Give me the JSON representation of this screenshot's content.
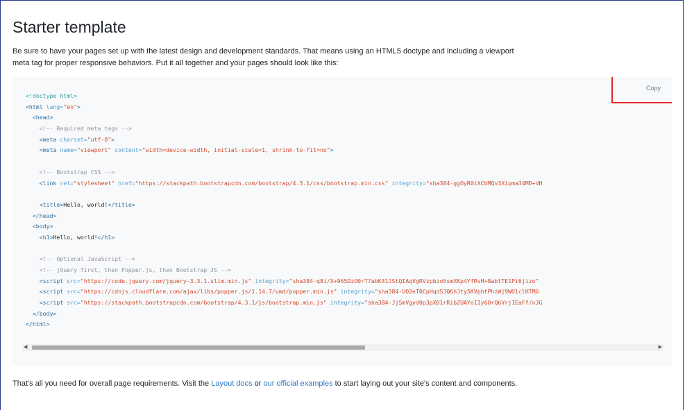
{
  "title": "Starter template",
  "intro": "Be sure to have your pages set up with the latest design and development standards. That means using an HTML5 doctype and including a viewport meta tag for proper responsive behaviors. Put it all together and your pages should look like this:",
  "copy_label": "Copy",
  "code_lines": [
    [
      {
        "c": "doc",
        "t": "<!doctype html>"
      }
    ],
    [
      {
        "c": "tag",
        "t": "<html"
      },
      {
        "c": "attr",
        "t": " lang="
      },
      {
        "c": "str",
        "t": "\"en\""
      },
      {
        "c": "tag",
        "t": ">"
      }
    ],
    [
      {
        "c": "txt",
        "t": "  "
      },
      {
        "c": "tag",
        "t": "<head>"
      }
    ],
    [
      {
        "c": "txt",
        "t": "    "
      },
      {
        "c": "com",
        "t": "<!-- Required meta tags -->"
      }
    ],
    [
      {
        "c": "txt",
        "t": "    "
      },
      {
        "c": "tag",
        "t": "<meta"
      },
      {
        "c": "attr",
        "t": " charset="
      },
      {
        "c": "str",
        "t": "\"utf-8\""
      },
      {
        "c": "tag",
        "t": ">"
      }
    ],
    [
      {
        "c": "txt",
        "t": "    "
      },
      {
        "c": "tag",
        "t": "<meta"
      },
      {
        "c": "attr",
        "t": " name="
      },
      {
        "c": "str",
        "t": "\"viewport\""
      },
      {
        "c": "attr",
        "t": " content="
      },
      {
        "c": "str",
        "t": "\"width=device-width, initial-scale=1, shrink-to-fit=no\""
      },
      {
        "c": "tag",
        "t": ">"
      }
    ],
    [
      {
        "c": "txt",
        "t": ""
      }
    ],
    [
      {
        "c": "txt",
        "t": "    "
      },
      {
        "c": "com",
        "t": "<!-- Bootstrap CSS -->"
      }
    ],
    [
      {
        "c": "txt",
        "t": "    "
      },
      {
        "c": "tag",
        "t": "<link"
      },
      {
        "c": "attr",
        "t": " rel="
      },
      {
        "c": "str",
        "t": "\"stylesheet\""
      },
      {
        "c": "attr",
        "t": " href="
      },
      {
        "c": "str",
        "t": "\"https://stackpath.bootstrapcdn.com/bootstrap/4.3.1/css/bootstrap.min.css\""
      },
      {
        "c": "attr",
        "t": " integrity="
      },
      {
        "c": "str",
        "t": "\"sha384-ggOyR0iXCbMQv3Xipma34MD+dH"
      }
    ],
    [
      {
        "c": "txt",
        "t": ""
      }
    ],
    [
      {
        "c": "txt",
        "t": "    "
      },
      {
        "c": "tag",
        "t": "<title>"
      },
      {
        "c": "txt",
        "t": "Hello, world!"
      },
      {
        "c": "tag",
        "t": "</title>"
      }
    ],
    [
      {
        "c": "txt",
        "t": "  "
      },
      {
        "c": "tag",
        "t": "</head>"
      }
    ],
    [
      {
        "c": "txt",
        "t": "  "
      },
      {
        "c": "tag",
        "t": "<body>"
      }
    ],
    [
      {
        "c": "txt",
        "t": "    "
      },
      {
        "c": "tag",
        "t": "<h1>"
      },
      {
        "c": "txt",
        "t": "Hello, world!"
      },
      {
        "c": "tag",
        "t": "</h1>"
      }
    ],
    [
      {
        "c": "txt",
        "t": ""
      }
    ],
    [
      {
        "c": "txt",
        "t": "    "
      },
      {
        "c": "com",
        "t": "<!-- Optional JavaScript -->"
      }
    ],
    [
      {
        "c": "txt",
        "t": "    "
      },
      {
        "c": "com",
        "t": "<!-- jQuery first, then Popper.js, then Bootstrap JS -->"
      }
    ],
    [
      {
        "c": "txt",
        "t": "    "
      },
      {
        "c": "tag",
        "t": "<script"
      },
      {
        "c": "attr",
        "t": " src="
      },
      {
        "c": "str",
        "t": "\"https://code.jquery.com/jquery-3.3.1.slim.min.js\""
      },
      {
        "c": "attr",
        "t": " integrity="
      },
      {
        "c": "str",
        "t": "\"sha384-q8i/X+965DzO0rT7abK41JStQIAqVgRVzpbzo5smXKp4YfRvH+8abtTE1Pi6jizo\""
      }
    ],
    [
      {
        "c": "txt",
        "t": "    "
      },
      {
        "c": "tag",
        "t": "<script"
      },
      {
        "c": "attr",
        "t": " src="
      },
      {
        "c": "str",
        "t": "\"https://cdnjs.cloudflare.com/ajax/libs/popper.js/1.14.7/umd/popper.min.js\""
      },
      {
        "c": "attr",
        "t": " integrity="
      },
      {
        "c": "str",
        "t": "\"sha384-UO2eT0CpHqdSJQ6hJty5KVphtPhzWj9WO1clHTMG"
      }
    ],
    [
      {
        "c": "txt",
        "t": "    "
      },
      {
        "c": "tag",
        "t": "<script"
      },
      {
        "c": "attr",
        "t": " src="
      },
      {
        "c": "str",
        "t": "\"https://stackpath.bootstrapcdn.com/bootstrap/4.3.1/js/bootstrap.min.js\""
      },
      {
        "c": "attr",
        "t": " integrity="
      },
      {
        "c": "str",
        "t": "\"sha384-JjSmVgyd0p3pXB1rRibZUAYoIIy6OrQ6VrjIEaFf/nJG"
      }
    ],
    [
      {
        "c": "txt",
        "t": "  "
      },
      {
        "c": "tag",
        "t": "</body>"
      }
    ],
    [
      {
        "c": "tag",
        "t": "</html>"
      }
    ]
  ],
  "scroll": {
    "left_arrow": "◀",
    "right_arrow": "▶",
    "position_fraction": 0.0
  },
  "outro": {
    "before": "That's all you need for overall page requirements. Visit the ",
    "link1": "Layout docs",
    "middle": " or ",
    "link2": "our official examples",
    "after": " to start laying out your site's content and components."
  },
  "colors": {
    "tag": "#2f6f9f",
    "attr": "#4f9fcf",
    "string": "#d14a2b",
    "comment": "#8f9399",
    "link": "#2a78c6",
    "highlight": "#e32626"
  }
}
